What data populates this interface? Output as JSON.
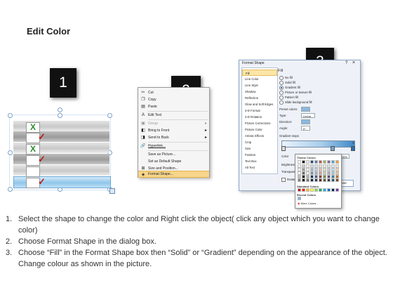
{
  "page": {
    "title": "Edit Color"
  },
  "badges": {
    "step1": "1",
    "step2": "2",
    "step3": "3"
  },
  "shape": {
    "rows": [
      {
        "mark": "x"
      },
      {
        "mark": "tick"
      },
      {
        "mark": "x"
      },
      {
        "mark": "tick"
      },
      {
        "mark": "none"
      },
      {
        "mark": "tick"
      }
    ],
    "x_glyph": "X",
    "tick_glyph": "✓"
  },
  "context_menu": {
    "items": [
      {
        "label": "Cut",
        "icon": "scissors-icon",
        "glyph": "✂",
        "state": "normal"
      },
      {
        "label": "Copy",
        "icon": "copy-icon",
        "glyph": "❐",
        "state": "normal"
      },
      {
        "label": "Paste",
        "icon": "paste-icon",
        "glyph": "▤",
        "state": "normal"
      },
      {
        "label": "Edit Text",
        "icon": "edit-text-icon",
        "glyph": "A",
        "state": "normal"
      },
      {
        "label": "Group",
        "icon": "group-icon",
        "glyph": "▣",
        "state": "disabled",
        "submenu": true
      },
      {
        "label": "Bring to Front",
        "icon": "bring-to-front-icon",
        "glyph": "◧",
        "state": "normal",
        "submenu": true
      },
      {
        "label": "Send to Back",
        "icon": "send-to-back-icon",
        "glyph": "◨",
        "state": "normal",
        "submenu": true
      },
      {
        "label": "Hyperlink...",
        "icon": "hyperlink-icon",
        "glyph": "🔗",
        "state": "normal"
      },
      {
        "label": "Save as Picture...",
        "icon": "",
        "glyph": "",
        "state": "normal"
      },
      {
        "label": "Set as Default Shape",
        "icon": "",
        "glyph": "",
        "state": "normal"
      },
      {
        "label": "Size and Position...",
        "icon": "size-position-icon",
        "glyph": "⊞",
        "state": "normal"
      },
      {
        "label": "Format Shape...",
        "icon": "format-shape-icon",
        "glyph": "◈",
        "state": "highlighted"
      }
    ]
  },
  "dialog": {
    "title": "Format Shape",
    "nav": [
      "Fill",
      "Line Color",
      "Line Style",
      "Shadow",
      "Reflection",
      "Glow and Soft Edges",
      "3-D Format",
      "3-D Rotation",
      "Picture Corrections",
      "Picture Color",
      "Artistic Effects",
      "Crop",
      "Size",
      "Position",
      "Text Box",
      "Alt Text"
    ],
    "panel_heading": "Fill",
    "fill_options": [
      {
        "label": "No fill",
        "selected": false
      },
      {
        "label": "Solid fill",
        "selected": false
      },
      {
        "label": "Gradient fill",
        "selected": true
      },
      {
        "label": "Picture or texture fill",
        "selected": false
      },
      {
        "label": "Pattern fill",
        "selected": false
      },
      {
        "label": "Slide background fill",
        "selected": false
      }
    ],
    "preset_colors_label": "Preset colors:",
    "type_label": "Type:",
    "type_value": "Linear",
    "direction_label": "Direction:",
    "angle_label": "Angle:",
    "angle_value": "0°",
    "gradient_stops_label": "Gradient stops",
    "color_label": "Color",
    "position_label": "Position:",
    "position_value": "70%",
    "brightness_label": "Brightness:",
    "transparency_label": "Transparen",
    "rotate_label": "Rotate with shape",
    "close_label": "Close"
  },
  "palette": {
    "theme_label": "Theme Colors",
    "standard_label": "Standard Colors",
    "recent_label": "Recent Colors",
    "more_label": "More Colors...",
    "theme_colors": [
      "#ffffff",
      "#000000",
      "#eeece1",
      "#1f497d",
      "#4f81bd",
      "#c0504d",
      "#9bbb59",
      "#8064a2",
      "#4bacc6",
      "#f79646"
    ],
    "standard_colors": [
      "#c00000",
      "#ff0000",
      "#ffc000",
      "#ffff00",
      "#92d050",
      "#00b050",
      "#00b0f0",
      "#0070c0",
      "#002060",
      "#7030a0"
    ],
    "recent_colors": [
      "#7fb2e5"
    ]
  },
  "instructions": [
    {
      "num": "1.",
      "text": "Select the shape to change the color and Right click the object( click any object which you want to change color)"
    },
    {
      "num": "2.",
      "text": "Choose Format Shape in the dialog box."
    },
    {
      "num": "3.",
      "text": "Choose “Fill” in the Format Shape box then “Solid” or “Gradient” depending on the appearance of the object. Change colour as shown in the picture."
    }
  ]
}
